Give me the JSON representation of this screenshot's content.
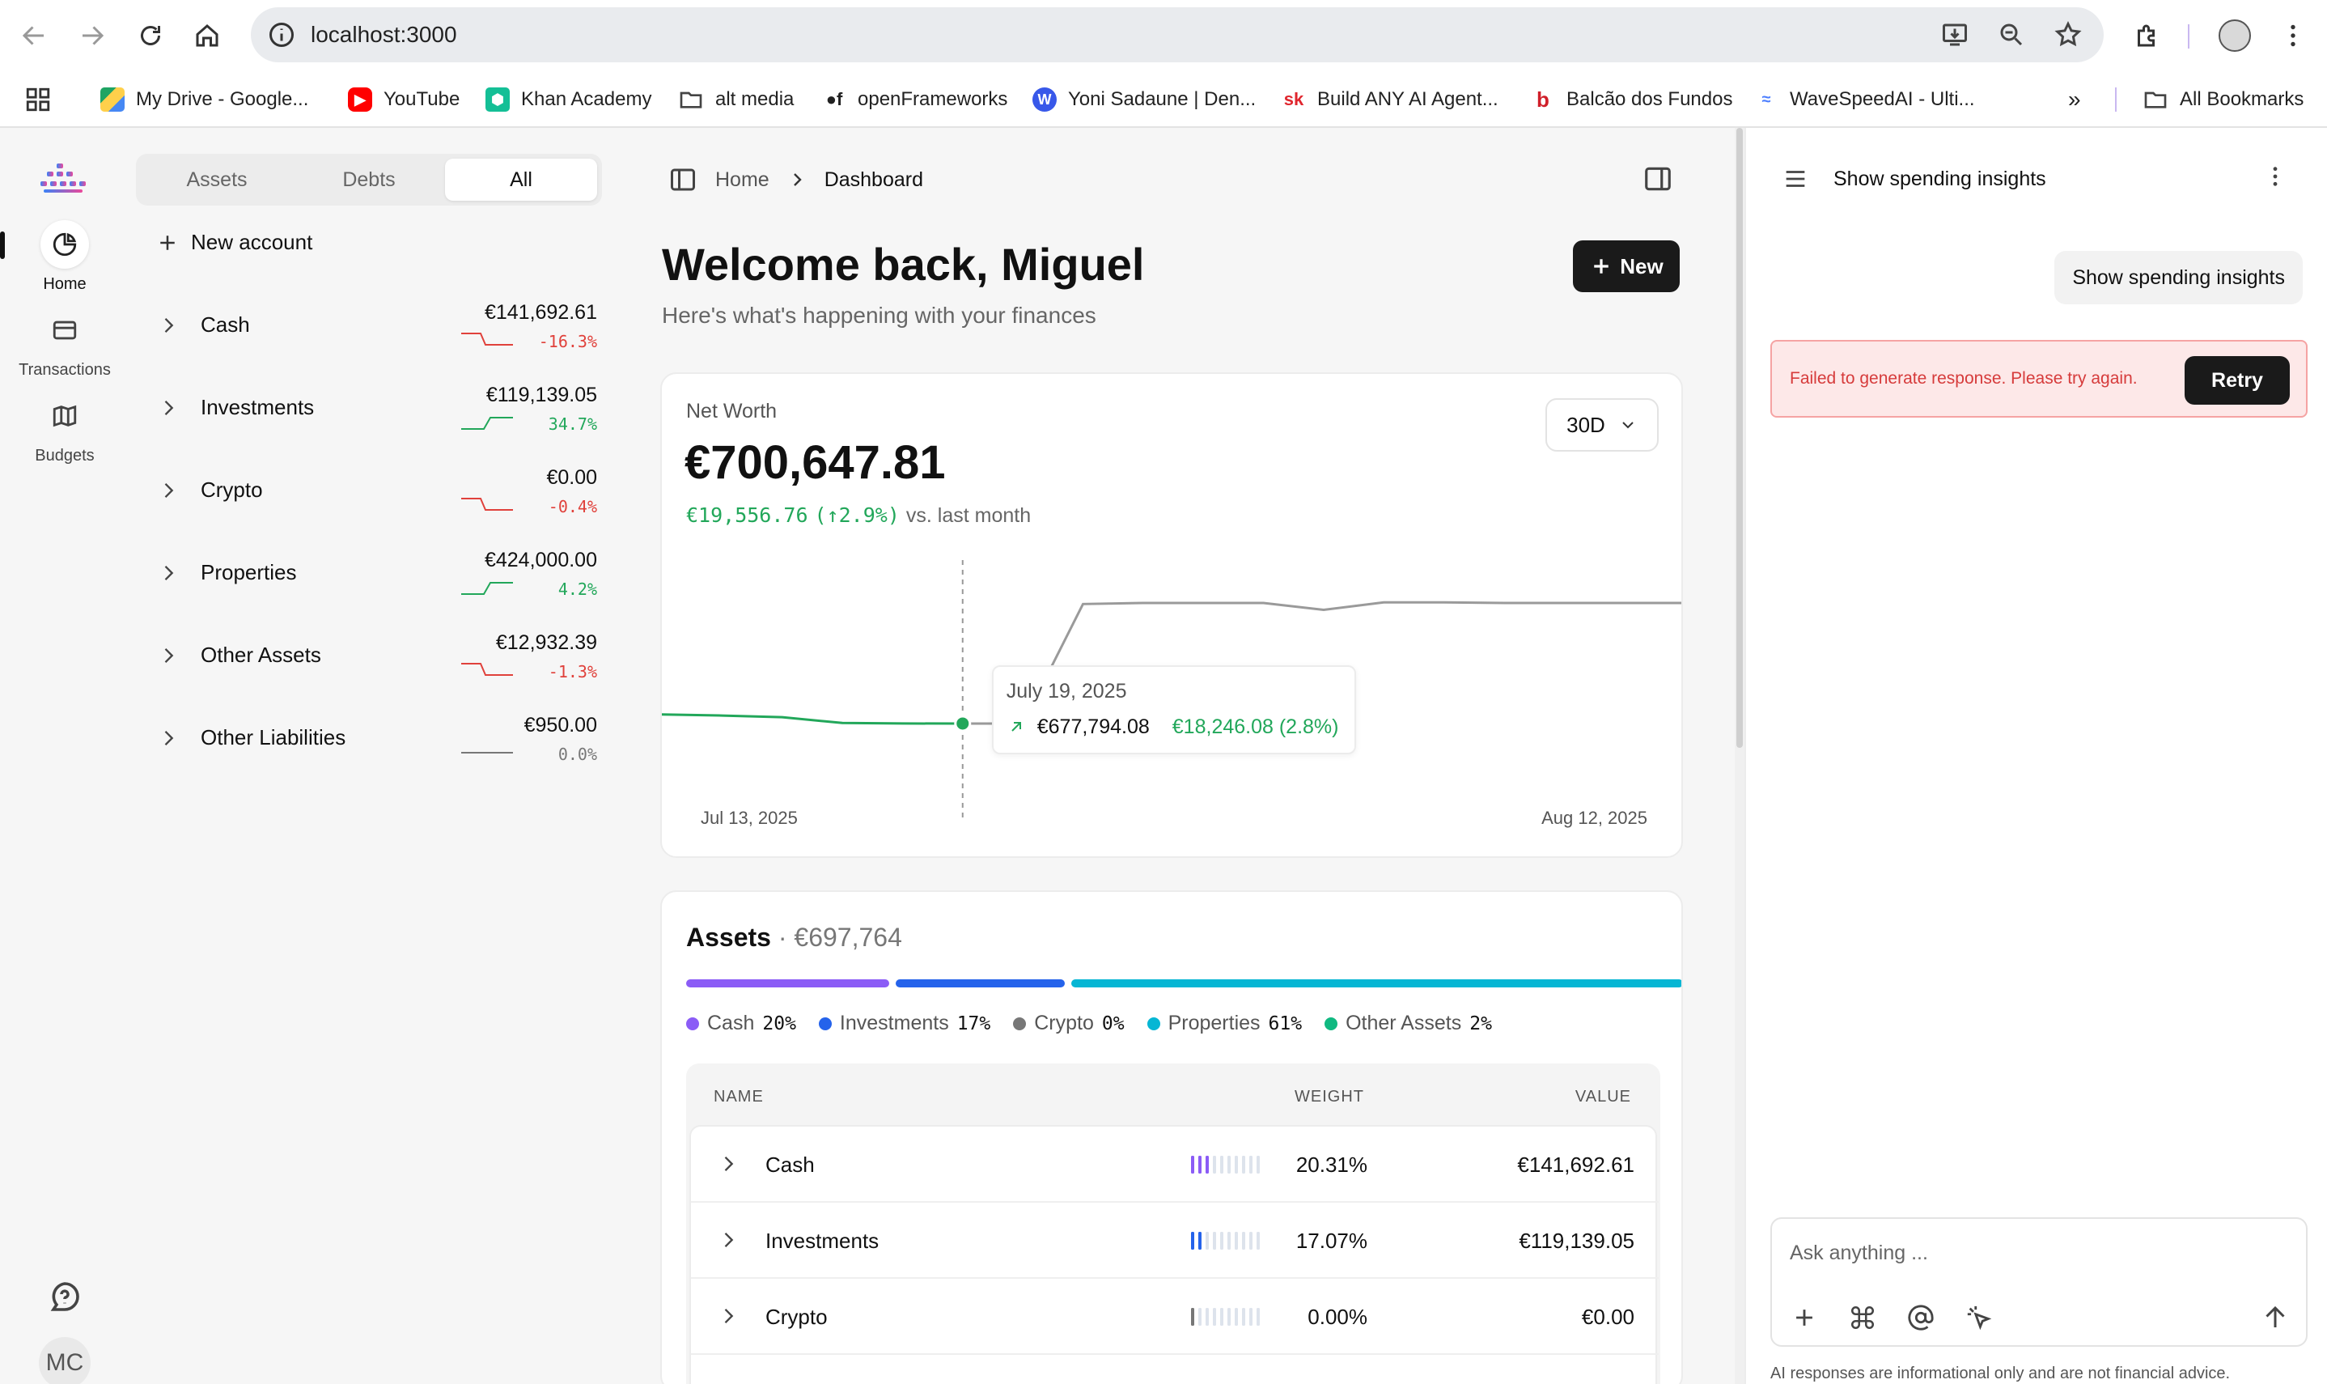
{
  "browser": {
    "url": "localhost:3000",
    "bookmarks": [
      {
        "label": "My Drive - Google...",
        "icon": "google-drive-icon"
      },
      {
        "label": "YouTube",
        "icon": "youtube-icon"
      },
      {
        "label": "Khan Academy",
        "icon": "khan-academy-icon"
      },
      {
        "label": "alt media",
        "icon": "folder-icon"
      },
      {
        "label": "openFrameworks",
        "icon": "openframeworks-icon"
      },
      {
        "label": "Yoni Sadaune | Den...",
        "icon": "wordpress-icon"
      },
      {
        "label": "Build ANY AI Agent...",
        "icon": "sk-icon"
      },
      {
        "label": "Balcão dos Fundos",
        "icon": "bdf-icon"
      },
      {
        "label": "WaveSpeedAI - Ulti...",
        "icon": "wavespeed-icon"
      }
    ],
    "all_bookmarks": "All Bookmarks"
  },
  "rail": {
    "home": "Home",
    "transactions": "Transactions",
    "budgets": "Budgets",
    "avatar_initials": "MC"
  },
  "accounts_panel": {
    "tabs": [
      "Assets",
      "Debts",
      "All"
    ],
    "active_tab": "All",
    "new_account": "New account",
    "groups": [
      {
        "name": "Cash",
        "value": "€141,692.61",
        "change": "-16.3%",
        "trend": "down",
        "color": "#e0413b"
      },
      {
        "name": "Investments",
        "value": "€119,139.05",
        "change": "34.7%",
        "trend": "up",
        "color": "#22a75a"
      },
      {
        "name": "Crypto",
        "value": "€0.00",
        "change": "-0.4%",
        "trend": "down",
        "color": "#e0413b"
      },
      {
        "name": "Properties",
        "value": "€424,000.00",
        "change": "4.2%",
        "trend": "up",
        "color": "#22a75a"
      },
      {
        "name": "Other Assets",
        "value": "€12,932.39",
        "change": "-1.3%",
        "trend": "down",
        "color": "#e0413b"
      },
      {
        "name": "Other Liabilities",
        "value": "€950.00",
        "change": "0.0%",
        "trend": "flat",
        "color": "#777777"
      }
    ]
  },
  "main": {
    "breadcrumb": {
      "home": "Home",
      "current": "Dashboard"
    },
    "welcome": "Welcome back, Miguel",
    "subtitle": "Here's what's happening with your finances",
    "new_button": "New",
    "net_worth": {
      "label": "Net Worth",
      "value": "€700,647.81",
      "change_value": "€19,556.76",
      "change_pct": "(↑2.9%)",
      "vs": "vs. last month",
      "range": "30D",
      "x_start": "Jul 13, 2025",
      "x_end": "Aug 12, 2025",
      "tooltip": {
        "date": "July 19, 2025",
        "value": "€677,794.08",
        "change": "€18,246.08 (2.8%)"
      }
    },
    "assets": {
      "title": "Assets",
      "total": "€697,764",
      "legend": [
        {
          "name": "Cash",
          "pct": "20%",
          "color": "#8b5cf6"
        },
        {
          "name": "Investments",
          "pct": "17%",
          "color": "#2563eb"
        },
        {
          "name": "Crypto",
          "pct": "0%",
          "color": "#777777"
        },
        {
          "name": "Properties",
          "pct": "61%",
          "color": "#06b6d4"
        },
        {
          "name": "Other Assets",
          "pct": "2%",
          "color": "#10b981"
        }
      ],
      "columns": {
        "name": "NAME",
        "weight": "WEIGHT",
        "value": "VALUE"
      },
      "rows": [
        {
          "name": "Cash",
          "weight": "20.31%",
          "value": "€141,692.61",
          "color": "#8b5cf6",
          "filled": 3
        },
        {
          "name": "Investments",
          "weight": "17.07%",
          "value": "€119,139.05",
          "color": "#2563eb",
          "filled": 2
        },
        {
          "name": "Crypto",
          "weight": "0.00%",
          "value": "€0.00",
          "color": "#777777",
          "filled": 1
        }
      ]
    }
  },
  "chat": {
    "title": "Show spending insights",
    "user_message": "Show spending insights",
    "error": "Failed to generate response. Please try again.",
    "retry": "Retry",
    "placeholder": "Ask anything ...",
    "disclaimer": "AI responses are informational only and are not financial advice."
  },
  "chart_data": {
    "type": "line",
    "x_start": "Jul 13, 2025",
    "x_end": "Aug 12, 2025",
    "hover": {
      "date": "July 19, 2025",
      "value": 677794.08
    },
    "series": [
      {
        "values": [
          679500,
          679300,
          679000,
          677900,
          677800,
          677794.08,
          677794.08,
          700300,
          700500,
          700500,
          700500,
          699200,
          700600,
          700600,
          700500,
          700500,
          700500,
          700500
        ]
      }
    ]
  }
}
